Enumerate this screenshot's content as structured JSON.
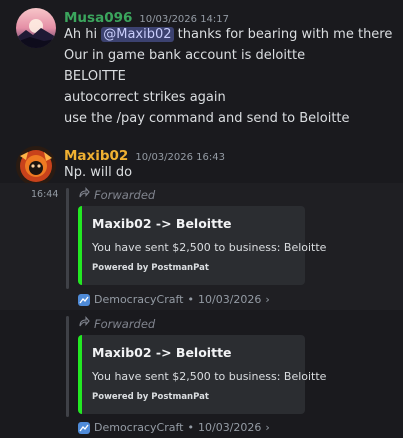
{
  "messages": [
    {
      "author": "Musa096",
      "author_color": "#3ba55d",
      "timestamp": "10/03/2026 14:17",
      "first_line": {
        "pre": "Ah hi ",
        "mention": "@Maxib02",
        "post": " thanks for bearing with me there"
      },
      "lines": [
        "Our in game bank account is deloitte",
        "BELOITTE",
        "autocorrect strikes again",
        "use the /pay command and send to Beloitte"
      ]
    },
    {
      "author": "Maxib02",
      "author_color": "#f0b132",
      "timestamp": "10/03/2026 16:43",
      "lines": [
        "Np. will do"
      ]
    }
  ],
  "forwards": [
    {
      "side_time": "16:44",
      "label": "Forwarded",
      "embed": {
        "title": "Maxib02 -> Beloitte",
        "description": "You have sent $2,500 to business: Beloitte",
        "footer": "Powered by PostmanPat",
        "accent": "#23e823"
      },
      "source": "DemocracyCraft",
      "date": "10/03/2026",
      "chevron": "›"
    },
    {
      "label": "Forwarded",
      "embed": {
        "title": "Maxib02 -> Beloitte",
        "description": "You have sent $2,500 to business: Beloitte",
        "footer": "Powered by PostmanPat",
        "accent": "#23e823"
      },
      "source": "DemocracyCraft",
      "date": "10/03/2026",
      "chevron": "›"
    }
  ],
  "separator": "•"
}
